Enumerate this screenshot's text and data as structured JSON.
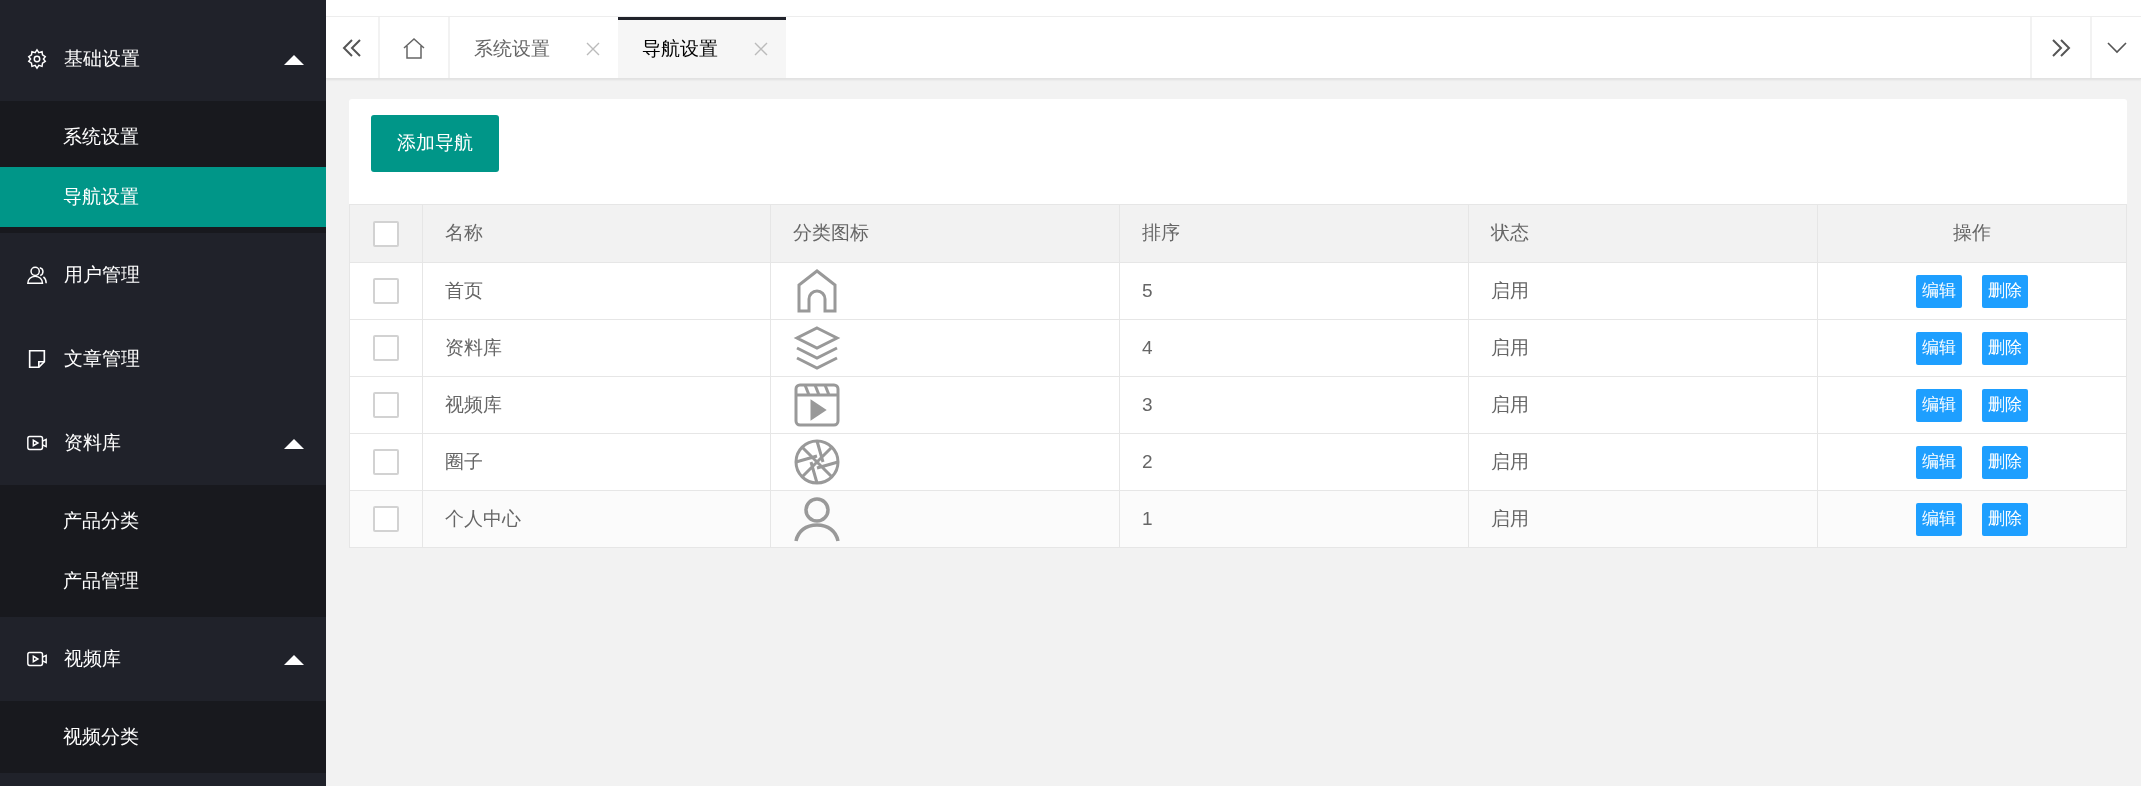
{
  "sidebar": {
    "items": [
      {
        "label": "基础设置",
        "expanded": true,
        "children": [
          {
            "label": "系统设置",
            "selected": false
          },
          {
            "label": "导航设置",
            "selected": true
          }
        ]
      },
      {
        "label": "用户管理"
      },
      {
        "label": "文章管理"
      },
      {
        "label": "资料库",
        "expanded": true,
        "children": [
          {
            "label": "产品分类",
            "selected": false
          },
          {
            "label": "产品管理",
            "selected": false
          }
        ]
      },
      {
        "label": "视频库",
        "expanded": true,
        "children": [
          {
            "label": "视频分类",
            "selected": false
          }
        ]
      }
    ]
  },
  "tabs": [
    {
      "label": "系统设置",
      "selected": false
    },
    {
      "label": "导航设置",
      "selected": true
    }
  ],
  "add_button": "添加导航",
  "table": {
    "columns": [
      "名称",
      "分类图标",
      "排序",
      "状态",
      "操作"
    ],
    "header_checked": false,
    "rows": [
      {
        "checked": false,
        "name": "首页",
        "sort": "5",
        "status": "启用",
        "actions": [
          "编辑",
          "删除"
        ]
      },
      {
        "checked": false,
        "name": "资料库",
        "sort": "4",
        "status": "启用",
        "actions": [
          "编辑",
          "删除"
        ]
      },
      {
        "checked": false,
        "name": "视频库",
        "sort": "3",
        "status": "启用",
        "actions": [
          "编辑",
          "删除"
        ]
      },
      {
        "checked": false,
        "name": "圈子",
        "sort": "2",
        "status": "启用",
        "actions": [
          "编辑",
          "删除"
        ]
      },
      {
        "checked": false,
        "name": "个人中心",
        "sort": "1",
        "status": "启用",
        "actions": [
          "编辑",
          "删除"
        ]
      }
    ]
  }
}
